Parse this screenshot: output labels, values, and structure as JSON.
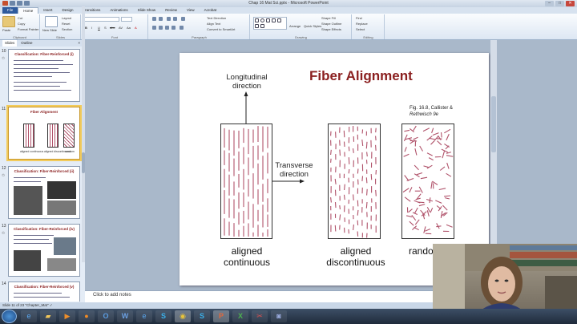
{
  "window": {
    "title": "Chap 16 Mat Sci.pptx - Microsoft PowerPoint",
    "controls": {
      "minimize": "–",
      "maximize": "□",
      "close": "✕"
    }
  },
  "ribbon": {
    "tabs": [
      "File",
      "Home",
      "Insert",
      "Design",
      "Transitions",
      "Animations",
      "Slide Show",
      "Review",
      "View",
      "Acrobat"
    ],
    "active_tab": "Home",
    "groups": [
      {
        "name": "Clipboard",
        "items": [
          "Paste",
          "Cut",
          "Copy",
          "Format Painter"
        ]
      },
      {
        "name": "Slides",
        "items": [
          "New Slide",
          "Layout",
          "Reset",
          "Section"
        ]
      },
      {
        "name": "Font",
        "items": [
          "B",
          "I",
          "U",
          "S",
          "abc",
          "AV",
          "Aa",
          "A"
        ]
      },
      {
        "name": "Paragraph",
        "items": [
          "Text Direction",
          "Align Text",
          "Convert to SmartArt"
        ]
      },
      {
        "name": "Drawing",
        "items": [
          "Arrange",
          "Quick Styles",
          "Shape Fill",
          "Shape Outline",
          "Shape Effects"
        ]
      },
      {
        "name": "Editing",
        "items": [
          "Find",
          "Replace",
          "Select"
        ]
      }
    ]
  },
  "panel": {
    "tabs": [
      "Slides",
      "Outline"
    ],
    "close": "×",
    "thumbnails": [
      {
        "number": "10",
        "title": "Classification: Fiber-Reinforced (i)"
      },
      {
        "number": "11",
        "title": "Fiber Alignment",
        "labels": [
          "aligned continuous",
          "aligned discontinuous",
          "random"
        ]
      },
      {
        "number": "12",
        "title": "Classification: Fiber-Reinforced (ii)"
      },
      {
        "number": "13",
        "title": "Classification: Fiber-Reinforced (iv)"
      },
      {
        "number": "14",
        "title": "Classification: Fiber-Reinforced (v)"
      }
    ]
  },
  "slide": {
    "title": "Fiber Alignment",
    "longitudinal": "Longitudinal\ndirection",
    "transverse": "Transverse\ndirection",
    "figure_caption_line1": "Fig. 16.8, Callister &",
    "figure_caption_line2": "Rethwisch 9e",
    "label_1": "aligned\ncontinuous",
    "label_2": "aligned\ndiscontinuous",
    "label_3": "rando"
  },
  "notes": {
    "placeholder": "Click to add notes"
  },
  "status": {
    "text": "Slide 11 of 23   \"Chapter_Mat\"   ✓"
  },
  "colors": {
    "accent": "#8b2020",
    "fiber": "#b0526a",
    "office_blue": "#2f5b9d"
  },
  "taskbar": {
    "icons": [
      "start-icon",
      "ie-icon",
      "folder-icon",
      "media-icon",
      "firefox-icon",
      "outlook-icon",
      "word-icon",
      "ie-icon-2",
      "skype-icon",
      "chrome-icon",
      "skype-icon-2",
      "powerpoint-icon",
      "excel-icon",
      "snipping-icon",
      "camera-icon"
    ]
  }
}
